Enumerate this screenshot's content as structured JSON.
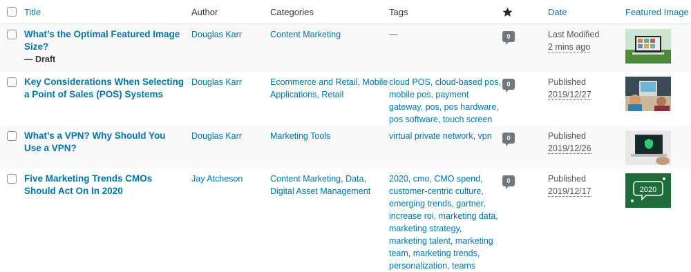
{
  "columns": {
    "title": "Title",
    "author": "Author",
    "categories": "Categories",
    "tags": "Tags",
    "comments_icon": "star-icon",
    "date": "Date",
    "featured_image": "Featured Image"
  },
  "rows": [
    {
      "title": "What’s the Optimal Featured Image Size?",
      "state": "— Draft",
      "author": "Douglas Karr",
      "categories": "Content Marketing",
      "tags": "—",
      "comments": "0",
      "date_label": "Last Modified",
      "date_value": "2 mins ago"
    },
    {
      "title": "Key Considerations When Selecting a Point of Sales (POS) Systems",
      "state": "",
      "author": "Douglas Karr",
      "categories": "Ecommerce and Retail, Mobile Applications, Retail",
      "tags": "cloud POS, cloud-based pos, mobile pos, payment gateway, pos, pos hardware, pos software, touch screen",
      "comments": "0",
      "date_label": "Published",
      "date_value": "2019/12/27"
    },
    {
      "title": "What’s a VPN? Why Should You Use a VPN?",
      "state": "",
      "author": "Douglas Karr",
      "categories": "Marketing Tools",
      "tags": "virtual private network, vpn",
      "comments": "0",
      "date_label": "Published",
      "date_value": "2019/12/26"
    },
    {
      "title": "Five Marketing Trends CMOs Should Act On In 2020",
      "state": "",
      "author": "Jay Atcheson",
      "categories": "Content Marketing, Data, Digital Asset Management",
      "tags": "2020, cmo, CMO spend, customer-centric culture, emerging trends, gartner, increase roi, marketing data, marketing strategy, marketing talent, marketing team, marketing trends, personalization, teams",
      "comments": "0",
      "date_label": "Published",
      "date_value": "2019/12/17",
      "thumb_text": "2020"
    }
  ]
}
